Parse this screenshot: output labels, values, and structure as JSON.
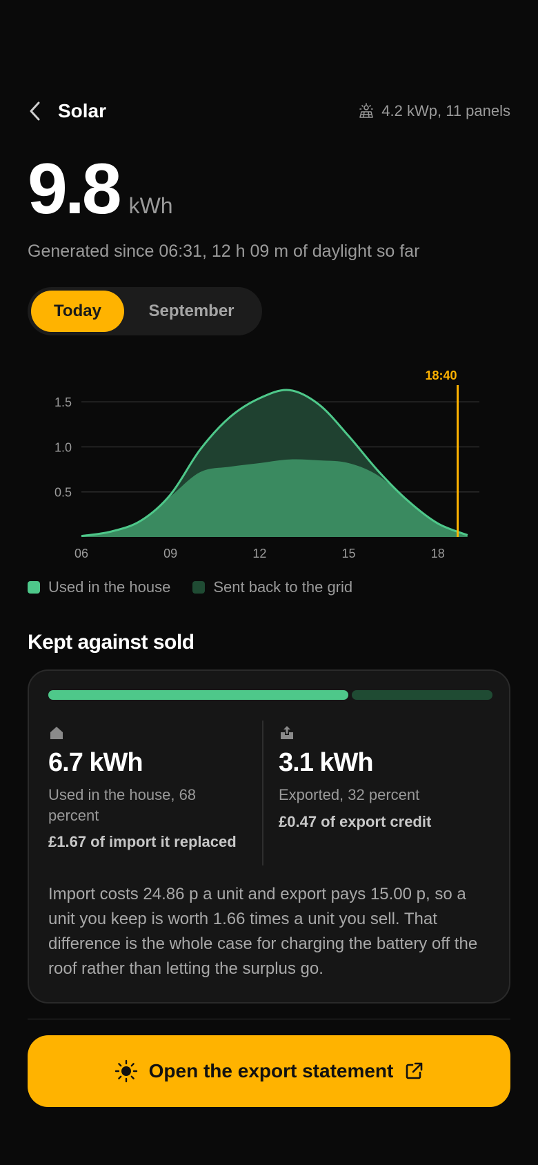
{
  "header": {
    "title": "Solar",
    "system_info": "4.2 kWp, 11 panels"
  },
  "summary": {
    "value": "9.8",
    "unit": "kWh",
    "subtitle": "Generated since 06:31, 12 h 09 m of daylight so far"
  },
  "tabs": [
    {
      "label": "Today",
      "active": true
    },
    {
      "label": "September",
      "active": false
    }
  ],
  "chart_data": {
    "type": "area",
    "x": [
      6,
      7,
      8,
      9,
      10,
      11,
      12,
      13,
      14,
      15,
      16,
      17,
      18,
      19
    ],
    "series": [
      {
        "name": "Used in the house",
        "values": [
          0.01,
          0.06,
          0.18,
          0.45,
          0.72,
          0.78,
          0.82,
          0.86,
          0.85,
          0.82,
          0.68,
          0.4,
          0.15,
          0.02
        ],
        "color": "#3a8a60"
      },
      {
        "name": "Sent back to the grid",
        "values": [
          0.0,
          0.0,
          0.0,
          0.02,
          0.25,
          0.55,
          0.72,
          0.77,
          0.62,
          0.3,
          0.05,
          0.0,
          0.0,
          0.0
        ],
        "color": "#1f4130"
      }
    ],
    "total_line_color": "#4ec88a",
    "x_ticks": [
      "06",
      "09",
      "12",
      "15",
      "18"
    ],
    "x_tick_values": [
      6,
      9,
      12,
      15,
      18
    ],
    "y_ticks": [
      "0.5",
      "1.0",
      "1.5"
    ],
    "y_tick_values": [
      0.5,
      1.0,
      1.5
    ],
    "ylim": [
      0,
      1.9
    ],
    "xlim": [
      6,
      19.4
    ],
    "marker": {
      "label": "18:40",
      "x": 18.67,
      "color": "#ffb300"
    },
    "grid": true
  },
  "legend": {
    "used": {
      "label": "Used in the house",
      "color": "#4ec88a"
    },
    "sent": {
      "label": "Sent back to the grid",
      "color": "#1f4b33"
    }
  },
  "comparison": {
    "title": "Kept against sold",
    "used_fraction": 0.68,
    "kept": {
      "value": "6.7 kWh",
      "desc": "Used in the house, 68 percent",
      "money": "£1.67 of import it replaced",
      "icon": "home-icon"
    },
    "sold": {
      "value": "3.1 kWh",
      "desc": "Exported, 32 percent",
      "money": "£0.47 of export credit",
      "icon": "export-icon"
    },
    "note": "Import costs 24.86 p a unit and export pays 15.00 p, so a unit you keep is worth 1.66 times a unit you sell. That difference is the whole case for charging the battery off the roof rather than letting the surplus go."
  },
  "cta": {
    "label": "Open the export statement",
    "icon_left": "sun-icon",
    "icon_right": "external-link-icon"
  },
  "colors": {
    "accent": "#ffb300",
    "green": "#4ec88a",
    "dark_green": "#1f4b33",
    "background": "#0a0a0a"
  }
}
